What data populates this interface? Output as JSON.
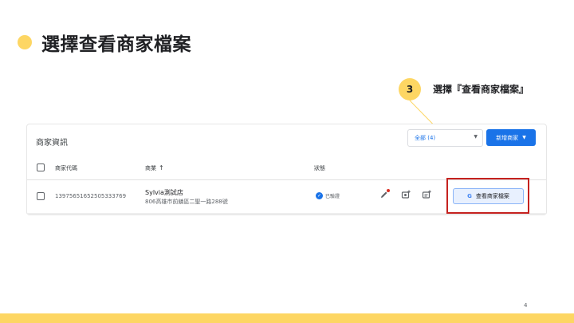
{
  "slide": {
    "title": "選擇查看商家檔案",
    "page_number": "4"
  },
  "callout": {
    "step": "3",
    "text": "選擇『查看商家檔案』"
  },
  "card": {
    "title": "商家資訊",
    "filter": {
      "selected": "全部 (4)"
    },
    "add_button": "新增商家",
    "columns": {
      "code": "商家代碼",
      "business": "商業",
      "status": "狀態"
    },
    "row": {
      "code": "13975651652505333769",
      "name": "Sylvia測試店",
      "address": "806高雄市前鎮區二聖一路288號",
      "status": "已驗證"
    },
    "profile_button": "查看商家檔案",
    "profile_button_icon": "G"
  },
  "colors": {
    "accent": "#fdd663",
    "primary": "#1a73e8",
    "highlight": "#c5221f"
  }
}
